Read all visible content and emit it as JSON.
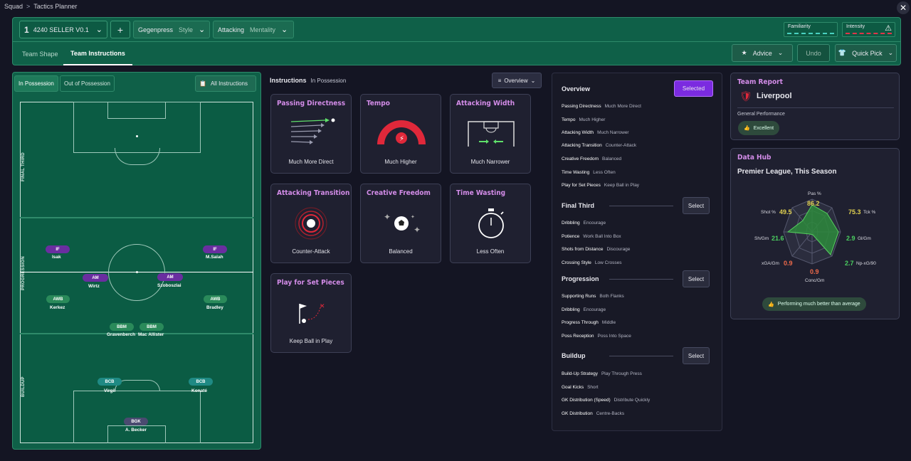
{
  "breadcrumb": {
    "root": "Squad",
    "current": "Tactics Planner"
  },
  "tactic": {
    "number": "1",
    "name": "4240 SELLER V0.1"
  },
  "dropdowns": [
    {
      "label": "Gegenpress",
      "sub": "Style"
    },
    {
      "label": "Attacking",
      "sub": "Mentality"
    }
  ],
  "metrics": {
    "familiarity": "Familiarity",
    "intensity": "Intensity"
  },
  "tabs": [
    "Team Shape",
    "Team Instructions"
  ],
  "buttons": {
    "advice": "Advice",
    "undo": "Undo",
    "quick_pick": "Quick Pick"
  },
  "possession": {
    "in": "In Possession",
    "out": "Out of Possession",
    "all": "All Instructions"
  },
  "zones": [
    "FINAL THIRD",
    "PROGRESSION",
    "BUILDUP"
  ],
  "players": [
    {
      "role": "IF",
      "name": "Isak"
    },
    {
      "role": "IF",
      "name": "M.Salah"
    },
    {
      "role": "AM",
      "name": "Wirtz"
    },
    {
      "role": "AM",
      "name": "Szoboszlai"
    },
    {
      "role": "AWB",
      "name": "Kerkez"
    },
    {
      "role": "AWB",
      "name": "Bradley"
    },
    {
      "role": "BBM",
      "name": "Gravenberch"
    },
    {
      "role": "BBM",
      "name": "Mac Allister"
    },
    {
      "role": "BCB",
      "name": "Virgil"
    },
    {
      "role": "BCB",
      "name": "Konaté"
    },
    {
      "role": "BGK",
      "name": "A. Becker"
    }
  ],
  "instructions": {
    "title": "Instructions",
    "sub": "In Possession",
    "view": "Overview",
    "cards": [
      {
        "title": "Passing Directness",
        "value": "Much More Direct"
      },
      {
        "title": "Tempo",
        "value": "Much Higher"
      },
      {
        "title": "Attacking Width",
        "value": "Much Narrower"
      },
      {
        "title": "Attacking Transition",
        "value": "Counter-Attack"
      },
      {
        "title": "Creative Freedom",
        "value": "Balanced"
      },
      {
        "title": "Time Wasting",
        "value": "Less Often"
      },
      {
        "title": "Play for Set Pieces",
        "value": "Keep Ball in Play"
      }
    ]
  },
  "overview": {
    "title": "Overview",
    "selected": "Selected",
    "select": "Select",
    "general": [
      {
        "k": "Passing Directness",
        "v": "Much More Direct"
      },
      {
        "k": "Tempo",
        "v": "Much Higher"
      },
      {
        "k": "Attacking Width",
        "v": "Much Narrower"
      },
      {
        "k": "Attacking Transition",
        "v": "Counter-Attack"
      },
      {
        "k": "Creative Freedom",
        "v": "Balanced"
      },
      {
        "k": "Time Wasting",
        "v": "Less Often"
      },
      {
        "k": "Play for Set Pieces",
        "v": "Keep Ball in Play"
      }
    ],
    "final_third": {
      "title": "Final Third",
      "items": [
        {
          "k": "Dribbling",
          "v": "Encourage"
        },
        {
          "k": "Potience",
          "v": "Work Ball Into Box"
        },
        {
          "k": "Shots from Distance",
          "v": "Discourage"
        },
        {
          "k": "Crossing Style",
          "v": "Low Crosses"
        }
      ]
    },
    "progression": {
      "title": "Progression",
      "items": [
        {
          "k": "Supporting Runs",
          "v": "Both Flanks"
        },
        {
          "k": "Dribbling",
          "v": "Encourage"
        },
        {
          "k": "Progress Through",
          "v": "Middle"
        },
        {
          "k": "Poss Reception",
          "v": "Poss Into Space"
        }
      ]
    },
    "buildup": {
      "title": "Buildup",
      "items": [
        {
          "k": "Build-Up Strategy",
          "v": "Play Through Press"
        },
        {
          "k": "Goal Kicks",
          "v": "Short"
        },
        {
          "k": "GK Distribution (Speed)",
          "v": "Distribute Quickly"
        },
        {
          "k": "GK Distribution",
          "v": "Centre-Backs"
        }
      ]
    }
  },
  "team_report": {
    "title": "Team Report",
    "team": "Liverpool",
    "perf_label": "General Performance",
    "perf": "Excellent"
  },
  "data_hub": {
    "title": "Data Hub",
    "scope": "Premier League, This Season",
    "summary": "Performing much better than average",
    "stats": [
      {
        "label": "Pas %",
        "value": "86.2"
      },
      {
        "label": "Tck %",
        "value": "75.3"
      },
      {
        "label": "Gl/Gm",
        "value": "2.9"
      },
      {
        "label": "Np-xG/90",
        "value": "2.7"
      },
      {
        "label": "Conc/Gm",
        "value": "0.9"
      },
      {
        "label": "xGA/Gm",
        "value": "0.9"
      },
      {
        "label": "Sh/Gm",
        "value": "21.6"
      },
      {
        "label": "Shot %",
        "value": "49.5"
      }
    ]
  }
}
